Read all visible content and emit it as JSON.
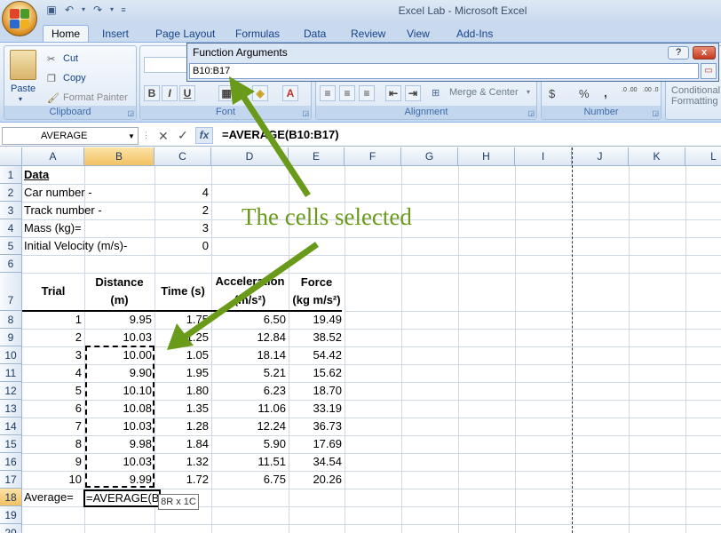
{
  "window": {
    "title": "Excel Lab - Microsoft Excel"
  },
  "tabs": [
    "Home",
    "Insert",
    "Page Layout",
    "Formulas",
    "Data",
    "Review",
    "View",
    "Add-Ins"
  ],
  "ribbon": {
    "clipboard": {
      "label": "Clipboard",
      "paste": "Paste",
      "cut": "Cut",
      "copy": "Copy",
      "format_painter": "Format Painter"
    },
    "font": {
      "label": "Font",
      "bold": "B",
      "italic": "I",
      "underline": "U"
    },
    "alignment": {
      "label": "Alignment",
      "merge_center": "Merge & Center"
    },
    "number": {
      "label": "Number",
      "currency": "$",
      "percent": "%",
      "comma": ",",
      "inc_decimal": ".0 .00",
      "dec_decimal": ".00 .0"
    },
    "styles": {
      "conditional": "Conditional",
      "formatting": "Formatting"
    }
  },
  "dialog": {
    "title": "Function Arguments",
    "input_value": "B10:B17",
    "help": "?",
    "close": "x"
  },
  "formula_bar": {
    "name_box": "AVERAGE",
    "fx": "fx",
    "cancel": "✕",
    "enter": "✓",
    "formula": "=AVERAGE(B10:B17)"
  },
  "columns": [
    "A",
    "B",
    "C",
    "D",
    "E",
    "F",
    "G",
    "H",
    "I",
    "J",
    "K",
    "L"
  ],
  "rows": [
    "1",
    "2",
    "3",
    "4",
    "5",
    "6",
    "7",
    "8",
    "9",
    "10",
    "11",
    "12",
    "13",
    "14",
    "15",
    "16",
    "17",
    "18",
    "19",
    "20"
  ],
  "sheet": {
    "a1": "Data",
    "a2": "Car number -",
    "c2": "4",
    "a3": "Track number -",
    "c3": "2",
    "a4": "Mass (kg)=",
    "c4": "3",
    "a5": "Initial Velocity (m/s)-",
    "c5": "0",
    "h_trial": "Trial",
    "h_distance_1": "Distance",
    "h_distance_2": "(m)",
    "h_time": "Time (s)",
    "h_accel_1": "Acceleration",
    "h_accel_2": "(m/s²)",
    "h_force_1": "Force",
    "h_force_2": "(kg m/s²)",
    "data": [
      {
        "trial": "1",
        "distance": "9.95",
        "time": "1.75",
        "accel": "6.50",
        "force": "19.49"
      },
      {
        "trial": "2",
        "distance": "10.03",
        "time": "1.25",
        "accel": "12.84",
        "force": "38.52"
      },
      {
        "trial": "3",
        "distance": "10.00",
        "time": "1.05",
        "accel": "18.14",
        "force": "54.42"
      },
      {
        "trial": "4",
        "distance": "9.90",
        "time": "1.95",
        "accel": "5.21",
        "force": "15.62"
      },
      {
        "trial": "5",
        "distance": "10.10",
        "time": "1.80",
        "accel": "6.23",
        "force": "18.70"
      },
      {
        "trial": "6",
        "distance": "10.08",
        "time": "1.35",
        "accel": "11.06",
        "force": "33.19"
      },
      {
        "trial": "7",
        "distance": "10.03",
        "time": "1.28",
        "accel": "12.24",
        "force": "36.73"
      },
      {
        "trial": "8",
        "distance": "9.98",
        "time": "1.84",
        "accel": "5.90",
        "force": "17.69"
      },
      {
        "trial": "9",
        "distance": "10.03",
        "time": "1.32",
        "accel": "11.51",
        "force": "34.54"
      },
      {
        "trial": "10",
        "distance": "9.99",
        "time": "1.72",
        "accel": "6.75",
        "force": "20.26"
      }
    ],
    "a18": "Average=",
    "b18_edit": "=AVERAGE(B10:B17",
    "tooltip": "8R x 1C"
  },
  "annotation": {
    "text": "The cells selected",
    "color": "#6a9a1a"
  }
}
